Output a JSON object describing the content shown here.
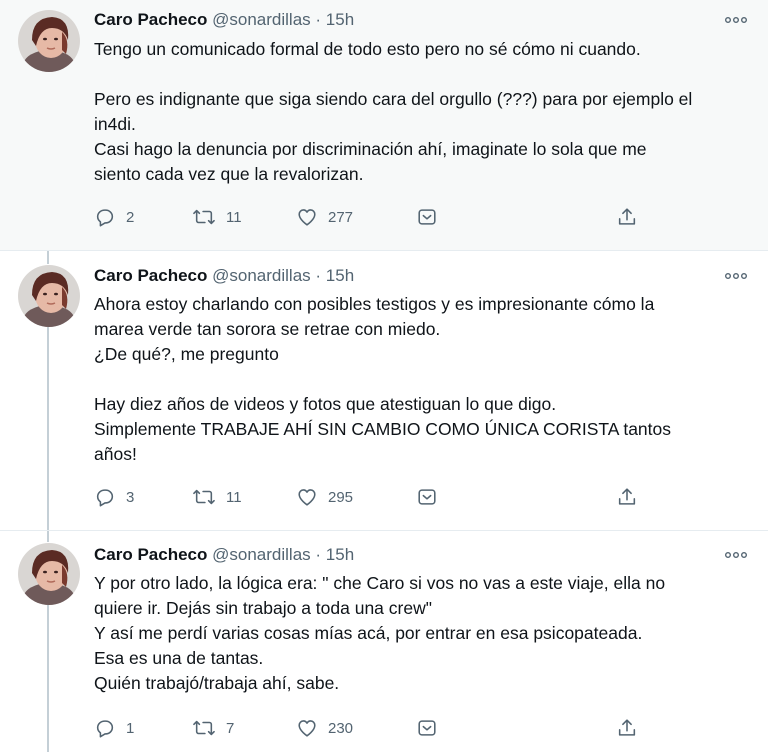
{
  "tweets": [
    {
      "author": "Caro Pacheco",
      "handle": "@sonardillas",
      "separator": "·",
      "time": "15h",
      "lines": [
        "Tengo un comunicado formal de todo esto pero no sé cómo ni cuando.",
        "",
        "Pero es indignante que siga siendo cara del orgullo (???) para por ejemplo el",
        "in4di.",
        "Casi hago la denuncia por discriminación ahí, imaginate lo sola que me",
        "siento cada vez que la revalorizan."
      ],
      "replies": "2",
      "retweets": "11",
      "likes": "277"
    },
    {
      "author": "Caro Pacheco",
      "handle": "@sonardillas",
      "separator": "·",
      "time": "15h",
      "lines": [
        "Ahora estoy charlando con posibles testigos y es impresionante cómo la",
        "marea verde tan sorora se retrae con miedo.",
        "¿De qué?, me pregunto",
        "",
        "Hay diez años de videos y fotos que atestiguan lo que digo.",
        "Simplemente TRABAJE AHÍ SIN CAMBIO COMO ÚNICA CORISTA tantos",
        "años!"
      ],
      "replies": "3",
      "retweets": "11",
      "likes": "295"
    },
    {
      "author": "Caro Pacheco",
      "handle": "@sonardillas",
      "separator": "·",
      "time": "15h",
      "lines": [
        "Y por otro lado, la lógica era: \" che Caro si vos no vas a este viaje, ella no",
        "quiere ir. Dejás sin trabajo a toda una crew\"",
        "Y así me perdí varias cosas mías acá, por entrar en esa psicopateada.",
        "Esa es una de tantas.",
        "Quién trabajó/trabaja ahí, sabe."
      ],
      "replies": "1",
      "retweets": "7",
      "likes": "230"
    }
  ],
  "colors": {
    "text": "#0f1419",
    "secondary": "#536471",
    "thread_line": "#c4cfd6",
    "highlight_bg": "#f7f9f9"
  },
  "icons": [
    "reply-icon",
    "retweet-icon",
    "like-icon",
    "share-dropdown-icon",
    "upload-icon",
    "more-options-icon"
  ]
}
